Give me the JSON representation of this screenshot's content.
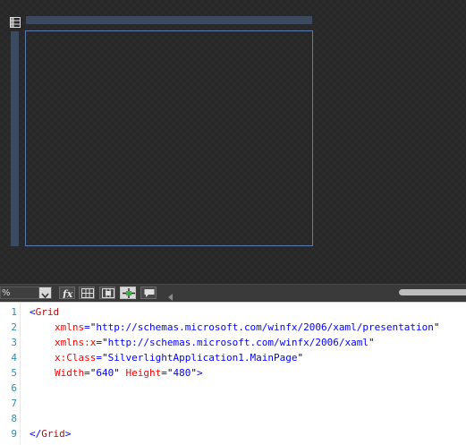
{
  "designer": {
    "colors": {
      "surface": "#2b2b2b",
      "ruler": "#3c4a60",
      "artboard_border": "#5b7bb5"
    }
  },
  "toolbar": {
    "zoom_value": "%",
    "buttons": [
      {
        "name": "formula-icon",
        "active": false
      },
      {
        "name": "grid-icon",
        "active": false
      },
      {
        "name": "snap-to-grid-icon",
        "active": false
      },
      {
        "name": "snaplines-icon",
        "active": true
      },
      {
        "name": "annotation-icon",
        "active": false
      }
    ]
  },
  "editor": {
    "line_numbers": [
      "1",
      "2",
      "3",
      "4",
      "5",
      "6",
      "7",
      "8",
      "9"
    ],
    "lines": [
      {
        "open": "<",
        "elem": "Grid"
      },
      {
        "attr": "xmlns",
        "eq": "=",
        "q1": "\"",
        "val": "http://schemas.microsoft.com/winfx/2006/xaml/presentation",
        "q2": "\""
      },
      {
        "attr": "xmlns:x",
        "eq": "=",
        "q1": "\"",
        "val": "http://schemas.microsoft.com/winfx/2006/xaml",
        "q2": "\""
      },
      {
        "attr": "x:Class",
        "eq": "=",
        "q1": "\"",
        "val": "SilverlightApplication1.MainPage",
        "q2": "\""
      },
      {
        "attr": "Width",
        "eq": "=",
        "q1": "\"",
        "val": "640",
        "q2": "\"",
        "attr2": "Height",
        "eq2": "=",
        "q3": "\"",
        "val2": "480",
        "q4": "\"",
        "close": ">"
      },
      {},
      {},
      {},
      {
        "open": "</",
        "elem": "Grid",
        "close": ">"
      }
    ]
  }
}
